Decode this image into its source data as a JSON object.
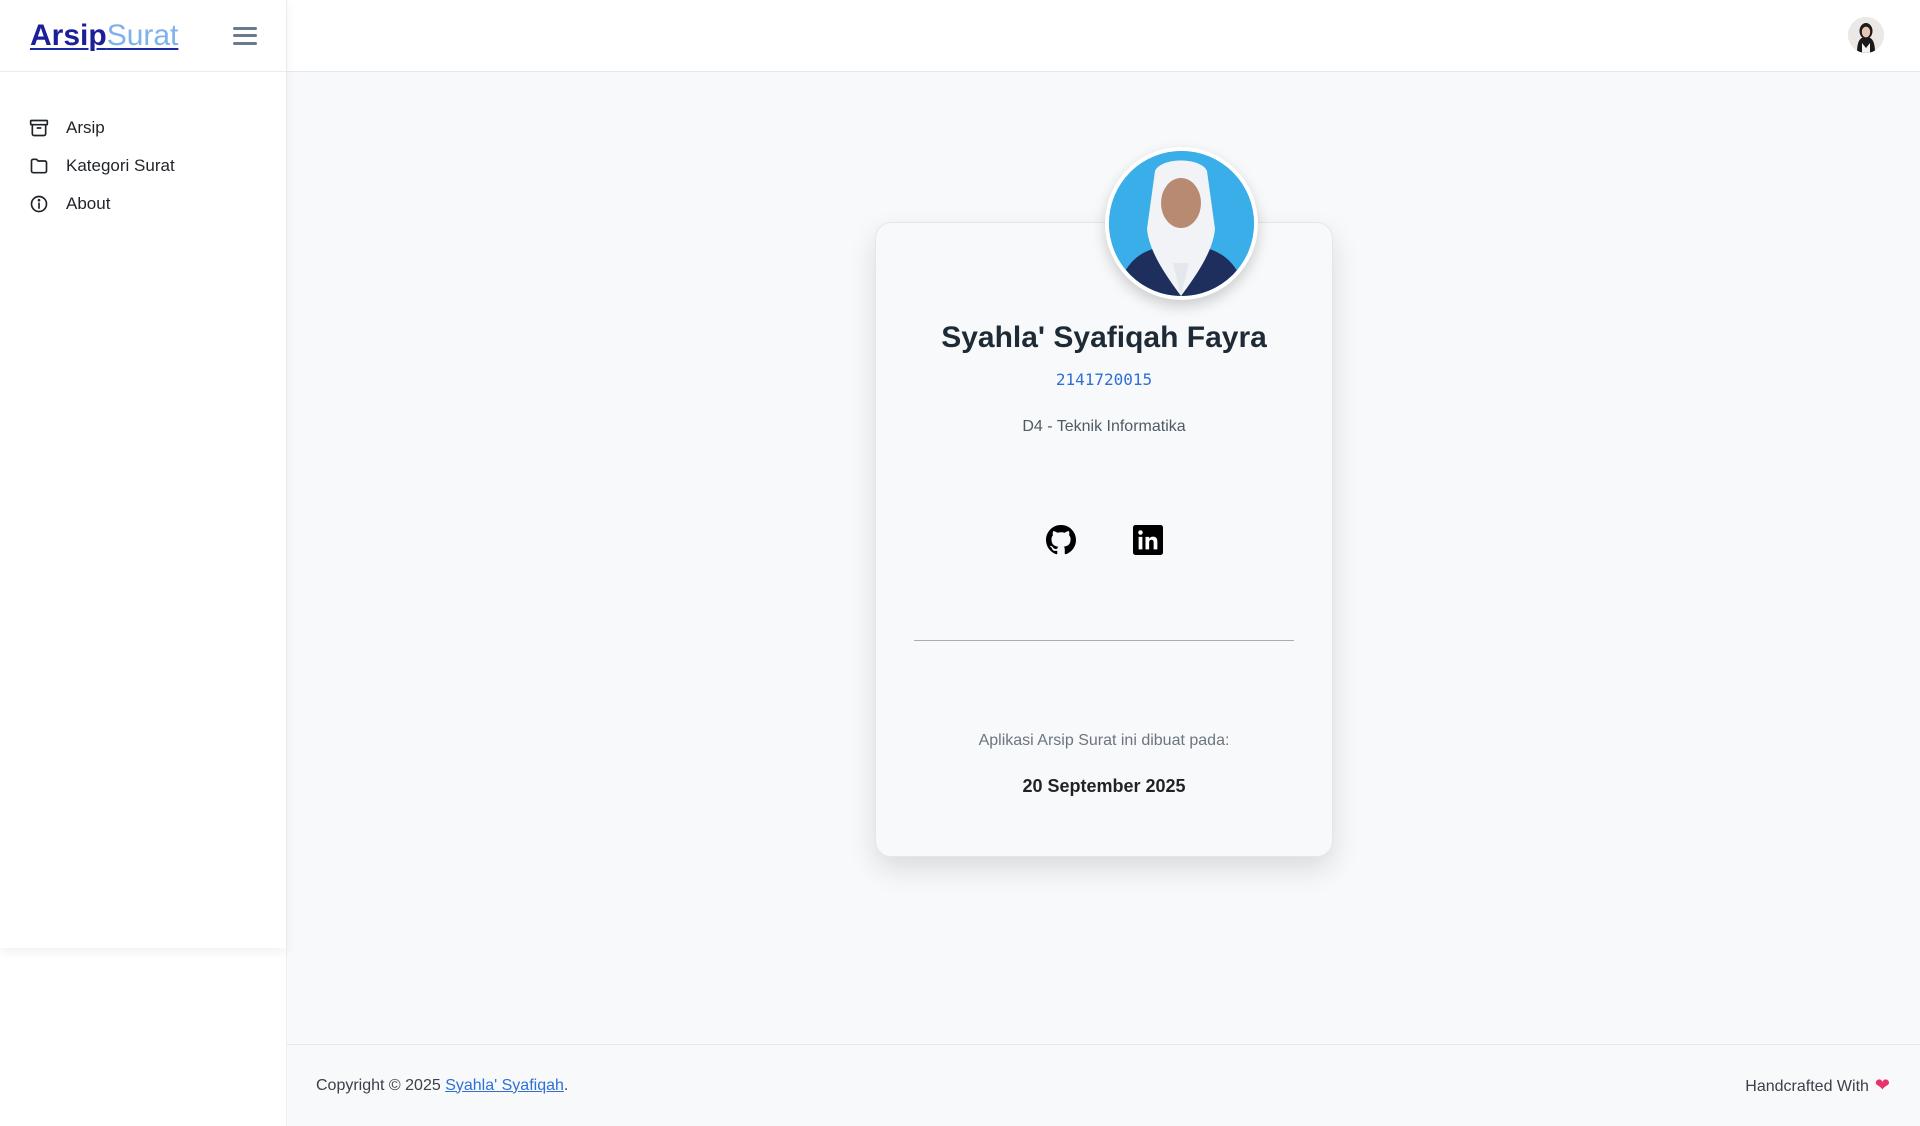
{
  "brand": {
    "part1": "Arsip",
    "part2": "Surat"
  },
  "sidebar": {
    "items": [
      {
        "label": "Arsip",
        "icon": "archive-icon"
      },
      {
        "label": "Kategori Surat",
        "icon": "folder-icon"
      },
      {
        "label": "About",
        "icon": "info-icon"
      }
    ]
  },
  "profile": {
    "name": "Syahla' Syafiqah Fayra",
    "nim": "2141720015",
    "program": "D4 - Teknik Informatika",
    "socials": [
      {
        "name": "GitHub",
        "icon": "github-icon"
      },
      {
        "name": "LinkedIn",
        "icon": "linkedin-icon"
      }
    ],
    "made_label": "Aplikasi Arsip Surat ini dibuat pada:",
    "made_date": "20 September 2025"
  },
  "footer": {
    "copyright_prefix": "Copyright © 2025 ",
    "author_link": "Syahla' Syafiqah",
    "copyright_suffix": ".",
    "handcrafted": "Handcrafted With",
    "heart": "❤"
  },
  "colors": {
    "brand_dark": "#1b1f9a",
    "brand_light": "#7fb2ec",
    "link": "#2f6fd6",
    "heart": "#e8336d"
  }
}
